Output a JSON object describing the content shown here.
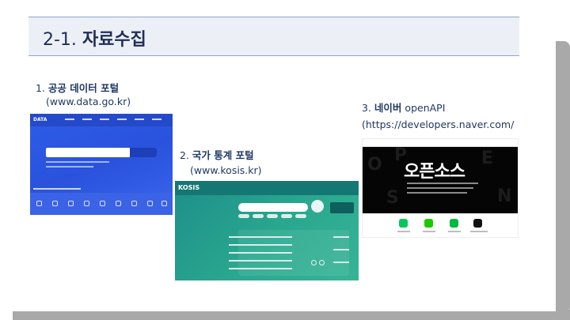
{
  "slide": {
    "title_number": "2-1.",
    "title_text": "자료수집",
    "down_arrow": "↓"
  },
  "sources": [
    {
      "number": "1.",
      "name": "공공 데이터 포털",
      "url": "(www.data.go.kr)",
      "screenshot_logo": "DATA"
    },
    {
      "number": "2.",
      "name": "국가 통계 포털",
      "url": "(www.kosis.kr)",
      "screenshot_logo": "KOSIS"
    },
    {
      "number": "3.",
      "name": "네이버",
      "name_suffix": "openAPI",
      "url": "(https://developers.naver.com/",
      "screenshot_heading": "오픈소스"
    }
  ],
  "colors": {
    "title_text": "#1f2f55",
    "title_band": "#ecf0f6",
    "label_text": "#1f3864",
    "data_go_kr": "#2d5de8",
    "kosis": "#2aa88f",
    "naver_hero": "#050505",
    "frame_shadow": "#a9a9a9"
  }
}
